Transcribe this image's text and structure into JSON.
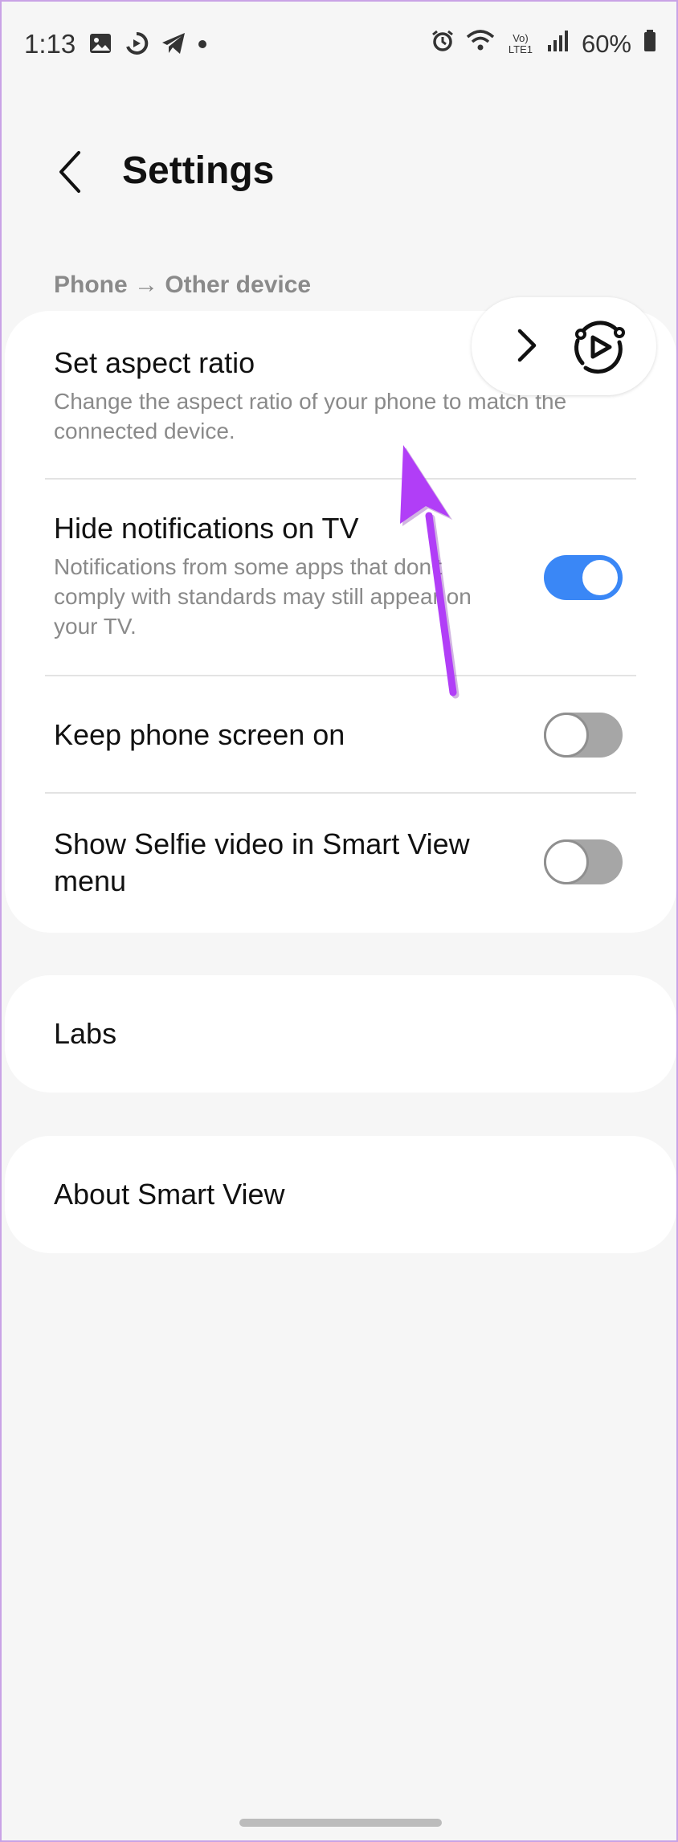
{
  "status_bar": {
    "time": "1:13",
    "network_label": "Vo) LTE1",
    "battery": "60%"
  },
  "header": {
    "title": "Settings"
  },
  "section": {
    "label": "Phone → Other device"
  },
  "settings": [
    {
      "title": "Set aspect ratio",
      "subtitle": "Change the aspect ratio of your phone to match the connected device."
    },
    {
      "title": "Hide notifications on TV",
      "subtitle": "Notifications from some apps that don't comply with standards may still appear on your TV.",
      "toggle": "on"
    },
    {
      "title": "Keep phone screen on",
      "toggle": "off"
    },
    {
      "title": "Show Selfie video in Smart View menu",
      "toggle": "off"
    }
  ],
  "labs": {
    "label": "Labs"
  },
  "about": {
    "label": "About Smart View"
  },
  "colors": {
    "accent": "#3a87f6",
    "annotation": "#b13ef7",
    "background": "#f6f6f6"
  },
  "icons": {
    "back": "chevron-left-icon",
    "float_expand": "chevron-right-icon",
    "smart_view": "smart-view-icon"
  }
}
